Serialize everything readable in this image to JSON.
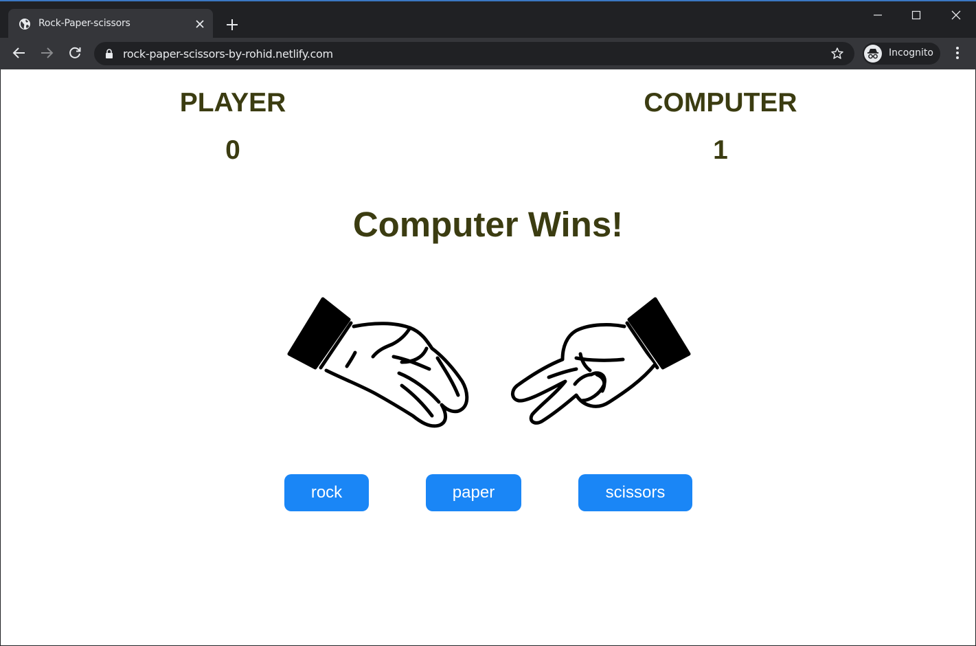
{
  "browser": {
    "tab_title": "Rock-Paper-scissors",
    "url": "rock-paper-scissors-by-rohid.netlify.com",
    "profile_label": "Incognito"
  },
  "game": {
    "player": {
      "label": "PLAYER",
      "score": "0"
    },
    "computer": {
      "label": "COMPUTER",
      "score": "1"
    },
    "result": "Computer Wins!",
    "player_hand": "paper-hand-icon",
    "computer_hand": "scissors-hand-icon",
    "buttons": {
      "rock": "rock",
      "paper": "paper",
      "scissors": "scissors"
    }
  },
  "colors": {
    "text": "#3b3c11",
    "button": "#1a86f6",
    "button_text": "#ffffff"
  }
}
